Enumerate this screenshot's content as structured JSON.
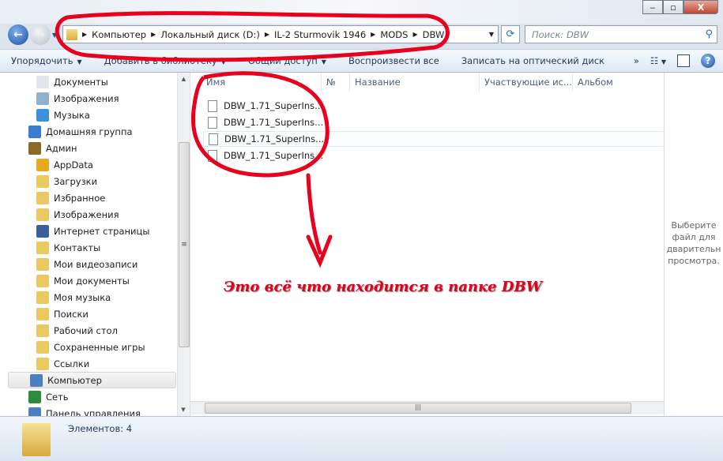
{
  "window": {
    "minimize": "‒",
    "maximize": "▫",
    "close": "X"
  },
  "address": {
    "crumbs": [
      "Компьютер",
      "Локальный диск (D:)",
      "IL-2 Sturmovik 1946",
      "MODS",
      "DBW"
    ]
  },
  "search": {
    "placeholder": "Поиск: DBW"
  },
  "toolbar": {
    "organize": "Упорядочить",
    "add_library": "Добавить в библиотеку",
    "share": "Общий доступ",
    "play_all": "Воспроизвести все",
    "burn": "Записать на оптический диск",
    "more": "»",
    "help": "?"
  },
  "sidebar": {
    "items": [
      {
        "label": "Документы",
        "icon": "documents-icon",
        "color": "#dfe6ef"
      },
      {
        "label": "Изображения",
        "icon": "pictures-icon",
        "color": "#8fb3cc"
      },
      {
        "label": "Музыка",
        "icon": "music-icon",
        "color": "#3d8fe0"
      },
      {
        "label": "Домашняя группа",
        "icon": "homegroup-icon",
        "color": "#3b7bd0"
      },
      {
        "label": "Админ",
        "icon": "user-icon",
        "color": "#8a6a2a"
      },
      {
        "label": "AppData",
        "icon": "appdata-icon",
        "color": "#e8a820"
      },
      {
        "label": "Загрузки",
        "icon": "folder-icon",
        "color": "#ecc860"
      },
      {
        "label": "Избранное",
        "icon": "folder-icon",
        "color": "#ecc860"
      },
      {
        "label": "Изображения",
        "icon": "folder-icon",
        "color": "#ecc860"
      },
      {
        "label": "Интернет страницы",
        "icon": "ie-icon",
        "color": "#3a5f9a"
      },
      {
        "label": "Контакты",
        "icon": "folder-icon",
        "color": "#ecc860"
      },
      {
        "label": "Мои видеозаписи",
        "icon": "folder-icon",
        "color": "#ecc860"
      },
      {
        "label": "Мои документы",
        "icon": "folder-icon",
        "color": "#ecc860"
      },
      {
        "label": "Моя музыка",
        "icon": "folder-icon",
        "color": "#ecc860"
      },
      {
        "label": "Поиски",
        "icon": "folder-icon",
        "color": "#ecc860"
      },
      {
        "label": "Рабочий стол",
        "icon": "folder-icon",
        "color": "#ecc860"
      },
      {
        "label": "Сохраненные игры",
        "icon": "folder-icon",
        "color": "#ecc860"
      },
      {
        "label": "Ссылки",
        "icon": "folder-icon",
        "color": "#ecc860"
      },
      {
        "label": "Компьютер",
        "icon": "computer-icon",
        "color": "#4a7fc0"
      },
      {
        "label": "Сеть",
        "icon": "network-icon",
        "color": "#2e8a3c"
      },
      {
        "label": "Панель управления",
        "icon": "control-panel-icon",
        "color": "#4a7fc0"
      }
    ]
  },
  "columns": [
    "Имя",
    "№",
    "Название",
    "Участвующие ис...",
    "Альбом"
  ],
  "files": [
    "DBW_1.71_SuperIns...",
    "DBW_1.71_SuperIns...",
    "DBW_1.71_SuperIns...",
    "DBW_1.71_SuperIns..."
  ],
  "preview": {
    "text": "Выберите файл для дварительн просмотра."
  },
  "status": {
    "count": "Элементов: 4"
  },
  "annotation": {
    "text": "Это всё что находится в папке DBW",
    "color": "#e0001a"
  }
}
